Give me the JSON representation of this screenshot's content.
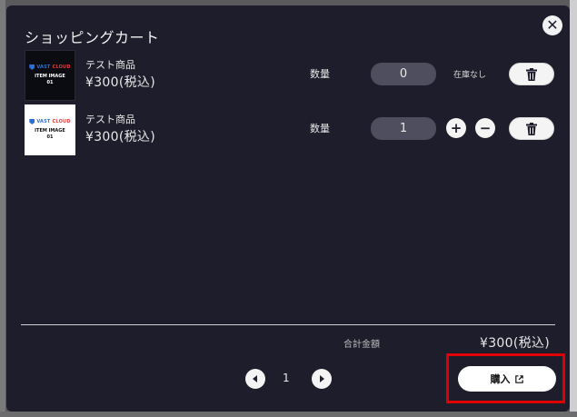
{
  "cart": {
    "title": "ショッピングカート",
    "quantity_label": "数量",
    "items": [
      {
        "name": "テスト商品",
        "price": "¥300(税込)",
        "quantity": "0",
        "stock_status": "在庫なし",
        "thumb": {
          "brand_vt": "VAST",
          "brand_cl": "CLOUD",
          "caption_line1": "ITEM IMAGE",
          "caption_line2": "01"
        }
      },
      {
        "name": "テスト商品",
        "price": "¥300(税込)",
        "quantity": "1",
        "thumb": {
          "brand_vt": "VAST",
          "brand_cl": "CLOUD",
          "caption_line1": "ITEM IMAGE",
          "caption_line2": "01"
        }
      }
    ],
    "total_label": "合計金額",
    "total_value": "¥300(税込)",
    "pagination": {
      "current_page": "1"
    },
    "purchase_label": "購入"
  },
  "icons": {
    "close": "close-icon",
    "trash": "trash-icon",
    "plus": "plus-icon",
    "minus": "minus-icon",
    "prev": "prev-page-icon",
    "next": "next-page-icon",
    "external": "external-link-icon"
  },
  "colors": {
    "modal_bg": "#1e1d2b",
    "qty_box": "#4e4e5e",
    "highlight": "#e00000",
    "brand_blue": "#2a6fd6",
    "brand_red": "#e23b3b"
  }
}
